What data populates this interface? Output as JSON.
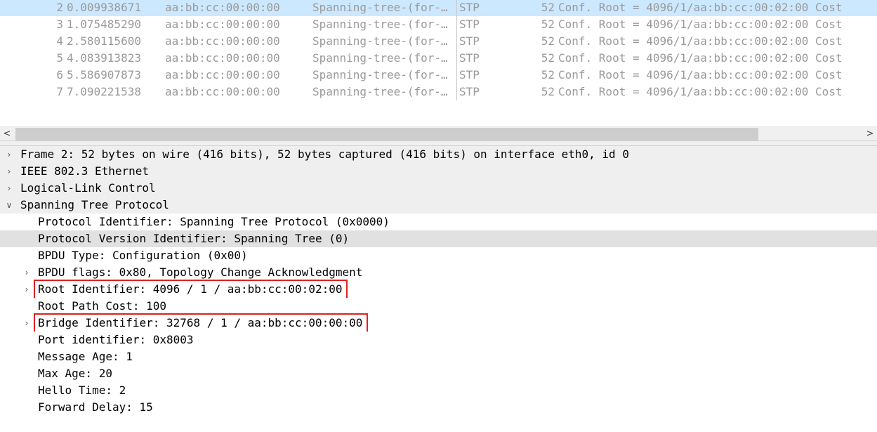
{
  "packets": [
    {
      "no": "2",
      "time": "0.009938671",
      "source": "aa:bb:cc:00:00:00",
      "destination": "Spanning-tree-(for-…",
      "protocol": "STP",
      "length": "52",
      "info": "Conf. Root = 4096/1/aa:bb:cc:00:02:00  Cost",
      "selected": true
    },
    {
      "no": "3",
      "time": "1.075485290",
      "source": "aa:bb:cc:00:00:00",
      "destination": "Spanning-tree-(for-…",
      "protocol": "STP",
      "length": "52",
      "info": "Conf. Root = 4096/1/aa:bb:cc:00:02:00  Cost"
    },
    {
      "no": "4",
      "time": "2.580115600",
      "source": "aa:bb:cc:00:00:00",
      "destination": "Spanning-tree-(for-…",
      "protocol": "STP",
      "length": "52",
      "info": "Conf. Root = 4096/1/aa:bb:cc:00:02:00  Cost"
    },
    {
      "no": "5",
      "time": "4.083913823",
      "source": "aa:bb:cc:00:00:00",
      "destination": "Spanning-tree-(for-…",
      "protocol": "STP",
      "length": "52",
      "info": "Conf. Root = 4096/1/aa:bb:cc:00:02:00  Cost"
    },
    {
      "no": "6",
      "time": "5.586907873",
      "source": "aa:bb:cc:00:00:00",
      "destination": "Spanning-tree-(for-…",
      "protocol": "STP",
      "length": "52",
      "info": "Conf. Root = 4096/1/aa:bb:cc:00:02:00  Cost"
    },
    {
      "no": "7",
      "time": "7.090221538",
      "source": "aa:bb:cc:00:00:00",
      "destination": "Spanning-tree-(for-…",
      "protocol": "STP",
      "length": "52",
      "info": "Conf. Root = 4096/1/aa:bb:cc:00:02:00  Cost"
    }
  ],
  "scrollbar": {
    "left_arrow": "<",
    "right_arrow": ">"
  },
  "details": [
    {
      "level": 0,
      "expander": "collapsed",
      "text": "Frame 2: 52 bytes on wire (416 bits), 52 bytes captured (416 bits) on interface eth0, id 0",
      "style": "top"
    },
    {
      "level": 0,
      "expander": "collapsed",
      "text": "IEEE 802.3 Ethernet",
      "style": "top"
    },
    {
      "level": 0,
      "expander": "collapsed",
      "text": "Logical-Link Control",
      "style": "top"
    },
    {
      "level": 0,
      "expander": "expanded",
      "text": "Spanning Tree Protocol",
      "style": "top"
    },
    {
      "level": 1,
      "expander": "none",
      "text": "Protocol Identifier: Spanning Tree Protocol (0x0000)",
      "style": "white"
    },
    {
      "level": 1,
      "expander": "none",
      "text": "Protocol Version Identifier: Spanning Tree (0)",
      "style": "hl"
    },
    {
      "level": 1,
      "expander": "none",
      "text": "BPDU Type: Configuration (0x00)",
      "style": "white"
    },
    {
      "level": 1,
      "expander": "collapsed",
      "text": "BPDU flags: 0x80, Topology Change Acknowledgment",
      "style": "white"
    },
    {
      "level": 1,
      "expander": "collapsed",
      "text": "Root Identifier: 4096 / 1 / aa:bb:cc:00:02:00",
      "style": "white",
      "boxed": true
    },
    {
      "level": 1,
      "expander": "none",
      "text": "Root Path Cost: 100",
      "style": "white"
    },
    {
      "level": 1,
      "expander": "collapsed",
      "text": "Bridge Identifier: 32768 / 1 / aa:bb:cc:00:00:00",
      "style": "white",
      "boxed": true
    },
    {
      "level": 1,
      "expander": "none",
      "text": "Port identifier: 0x8003",
      "style": "white"
    },
    {
      "level": 1,
      "expander": "none",
      "text": "Message Age: 1",
      "style": "white"
    },
    {
      "level": 1,
      "expander": "none",
      "text": "Max Age: 20",
      "style": "white"
    },
    {
      "level": 1,
      "expander": "none",
      "text": "Hello Time: 2",
      "style": "white"
    },
    {
      "level": 1,
      "expander": "none",
      "text": "Forward Delay: 15",
      "style": "white"
    }
  ],
  "colors": {
    "selected_row": "#cce8ff",
    "annotation_box": "#e02020",
    "dim_text": "#9a9a9a"
  }
}
